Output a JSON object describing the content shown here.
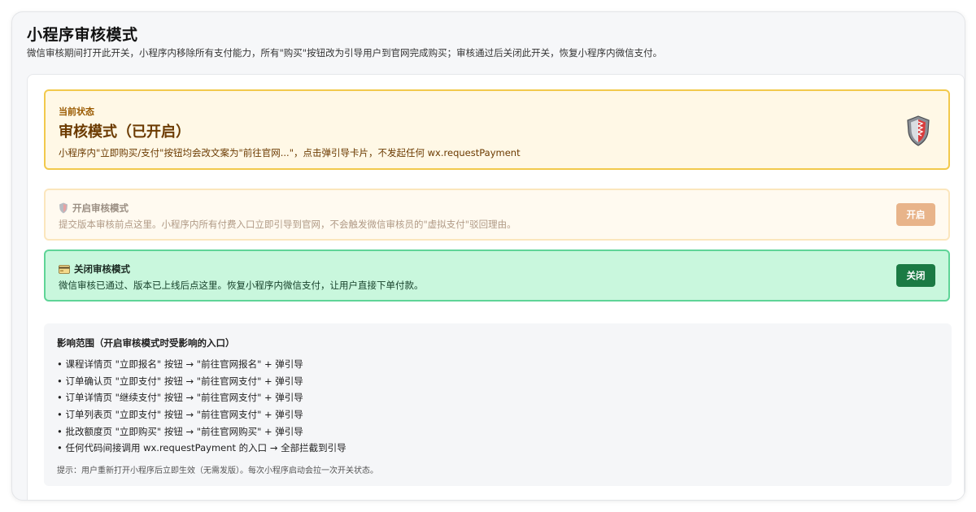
{
  "header": {
    "title": "小程序审核模式",
    "description": "微信审核期间打开此开关，小程序内移除所有支付能力，所有\"购买\"按钮改为引导用户到官网完成购买；审核通过后关闭此开关，恢复小程序内微信支付。"
  },
  "status": {
    "label": "当前状态",
    "title": "审核模式（已开启）",
    "description": "小程序内\"立即购买/支付\"按钮均会改文案为\"前往官网...\"，点击弹引导卡片，不发起任何 wx.requestPayment",
    "icon": "shield-icon"
  },
  "open_card": {
    "title": "开启审核模式",
    "description": "提交版本审核前点这里。小程序内所有付费入口立即引导到官网，不会触发微信审核员的\"虚拟支付\"驳回理由。",
    "button_label": "开启",
    "icon": "shield-icon"
  },
  "close_card": {
    "title": "关闭审核模式",
    "description": "微信审核已通过、版本已上线后点这里。恢复小程序内微信支付，让用户直接下单付款。",
    "button_label": "关闭",
    "icon": "credit-card-icon"
  },
  "scope": {
    "title": "影响范围（开启审核模式时受影响的入口）",
    "items": [
      "• 课程详情页 \"立即报名\" 按钮 → \"前往官网报名\" + 弹引导",
      "• 订单确认页 \"立即支付\" 按钮 → \"前往官网支付\" + 弹引导",
      "• 订单详情页 \"继续支付\" 按钮 → \"前往官网支付\" + 弹引导",
      "• 订单列表页 \"立即支付\" 按钮 → \"前往官网支付\" + 弹引导",
      "• 批改额度页 \"立即购买\" 按钮 → \"前往官网购买\" + 弹引导",
      "• 任何代码间接调用 wx.requestPayment 的入口 → 全部拦截到引导"
    ],
    "tip": "提示：用户重新打开小程序后立即生效（无需发版）。每次小程序启动会拉一次开关状态。"
  },
  "colors": {
    "status_bg": "#fff8e6",
    "status_border": "#f2c94c",
    "open_button": "#e8b48a",
    "close_button": "#1b7a44",
    "close_card_bg": "#c9f7dd"
  }
}
